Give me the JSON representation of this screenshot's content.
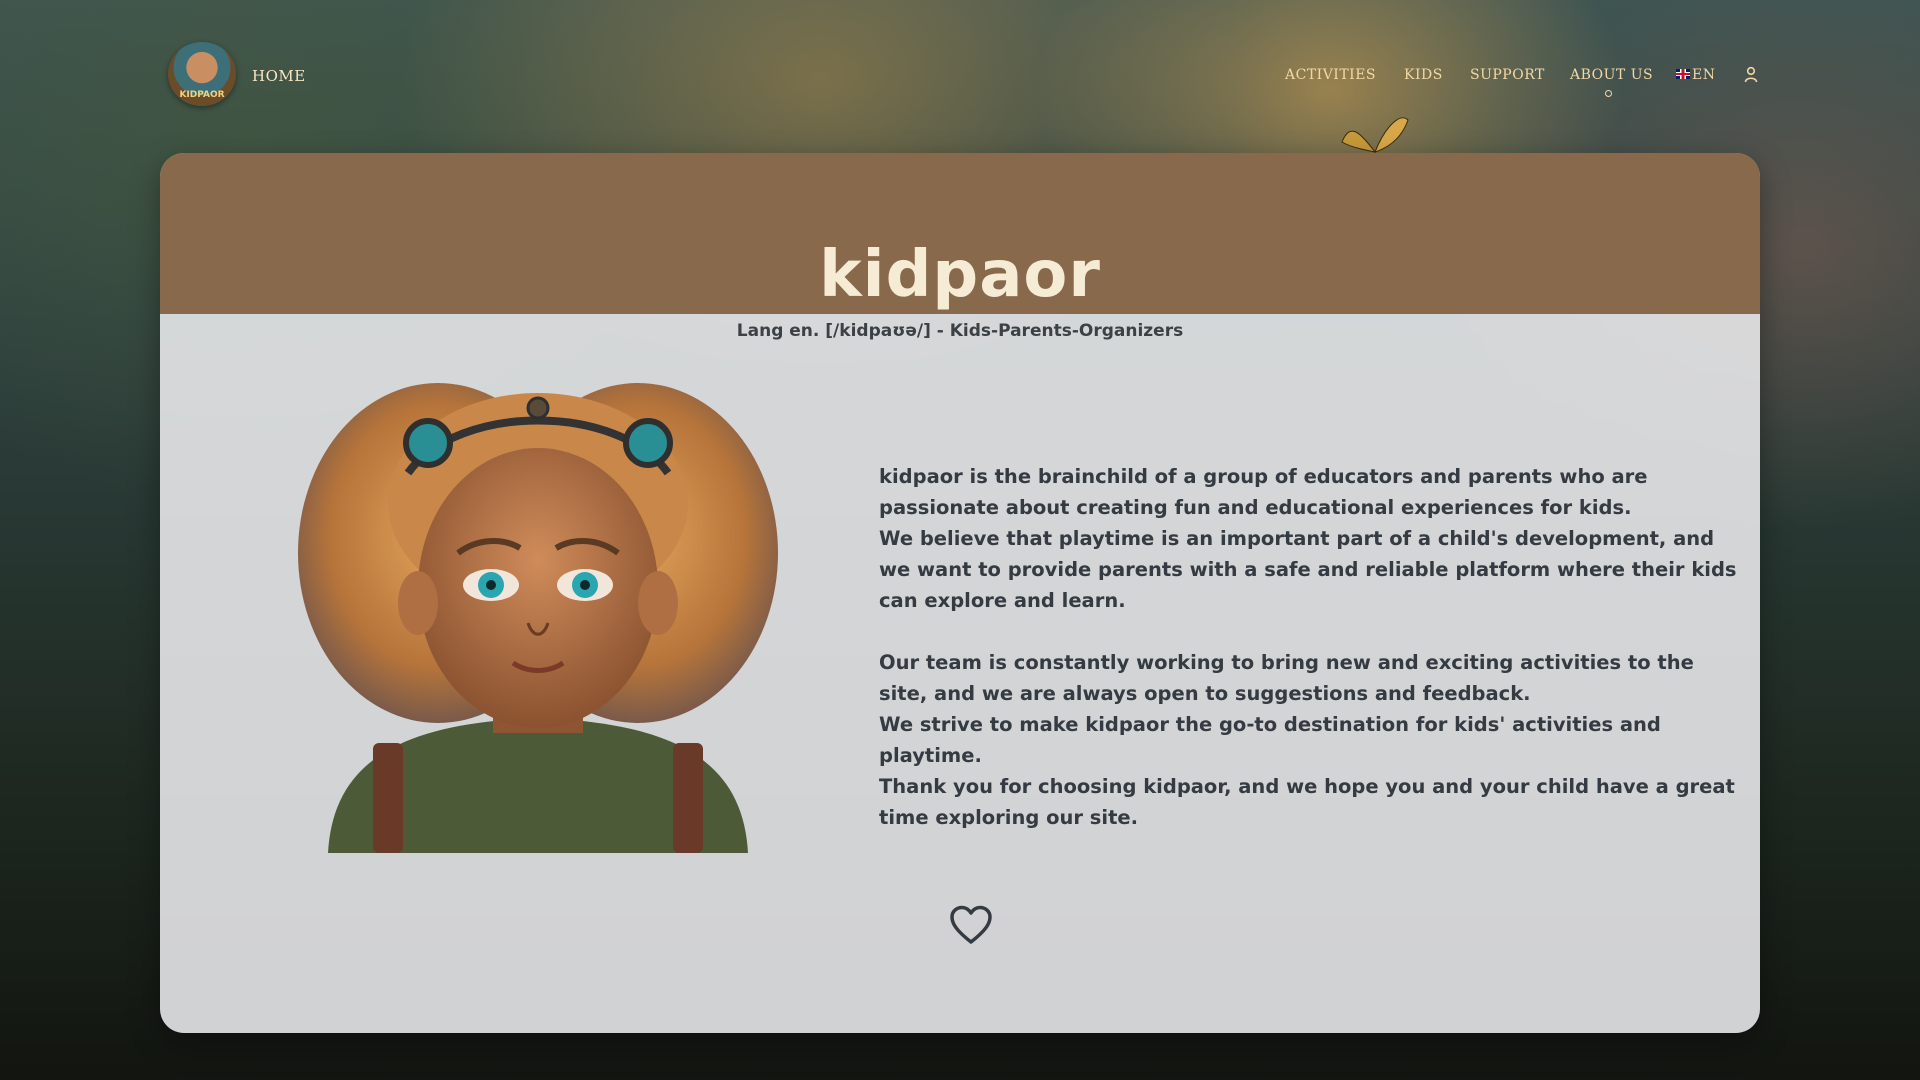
{
  "nav": {
    "logo_text": "KIDPAOR",
    "home": "HOME",
    "items": [
      {
        "label": "ACTIVITIES"
      },
      {
        "label": "KIDS"
      },
      {
        "label": "SUPPORT"
      },
      {
        "label": "ABOUT US"
      }
    ],
    "language": "EN",
    "active_item": "ABOUT US",
    "icons": {
      "flag": "uk-flag-icon",
      "user": "user-icon"
    }
  },
  "card": {
    "title": "kidpaor",
    "subtitle": "Lang en. [/kidpaʊə/] - Kids-Parents-Organizers",
    "paragraphs": [
      "kidpaor is the brainchild of a group of educators and parents who are passionate about creating fun and educational experiences for kids.",
      "We believe that playtime is an important part of a child's development, and we want to provide parents with a safe and reliable platform where their kids can explore and learn.",
      "Our team is constantly working to bring new and exciting activities to the site, and we are always open to suggestions and feedback.",
      "We strive to make kidpaor the go-to destination for kids' activities and playtime.",
      "Thank you for choosing kidpaor, and we hope you and your child have a great time exploring our site."
    ],
    "icons": {
      "like": "heart-icon"
    }
  },
  "colors": {
    "header_brown": "#88694c",
    "title_cream": "#f6ecd6",
    "nav_gold": "#f2d8a6",
    "body_text": "#353b42"
  }
}
